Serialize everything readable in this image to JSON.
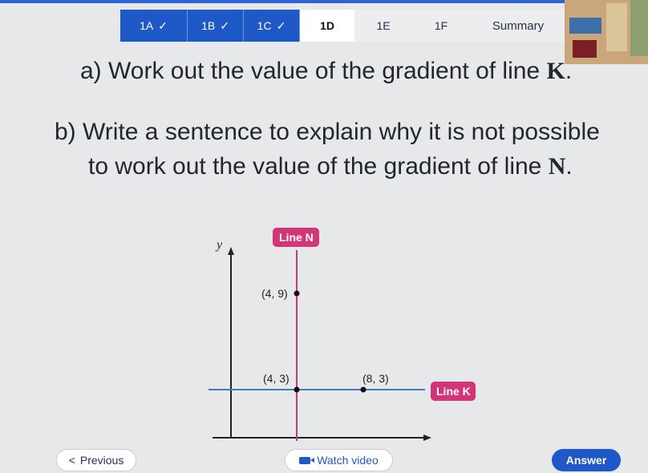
{
  "tabs": [
    {
      "label": "1A",
      "status": "done",
      "check": "✓"
    },
    {
      "label": "1B",
      "status": "done",
      "check": "✓"
    },
    {
      "label": "1C",
      "status": "done",
      "check": "✓"
    },
    {
      "label": "1D",
      "status": "active"
    },
    {
      "label": "1E",
      "status": "todo"
    },
    {
      "label": "1F",
      "status": "todo"
    },
    {
      "label": "Summary",
      "status": "todo"
    }
  ],
  "question": {
    "part_a_prefix": "a) Work out the value of the gradient of line ",
    "part_a_letter": "K",
    "part_a_suffix": ".",
    "part_b_line1": "b) Write a sentence to explain why it is not possible",
    "part_b_line2_prefix": "to work out the value of the gradient of line ",
    "part_b_letter": "N",
    "part_b_suffix": "."
  },
  "graph": {
    "y_axis_label": "y",
    "line_n_label": "Line N",
    "line_k_label": "Line K",
    "points": [
      {
        "label": "(4, 9)"
      },
      {
        "label": "(4, 3)"
      },
      {
        "label": "(8, 3)"
      }
    ],
    "colors": {
      "line_n": "#d23677",
      "line_k": "#4a78b8",
      "axis": "#222222"
    }
  },
  "footer": {
    "previous_label": "Previous",
    "previous_icon": "chevron-left-icon",
    "video_label": "Watch video",
    "video_icon": "video-icon",
    "answer_label": "Answer"
  },
  "colors": {
    "accent": "#1f59c7"
  }
}
